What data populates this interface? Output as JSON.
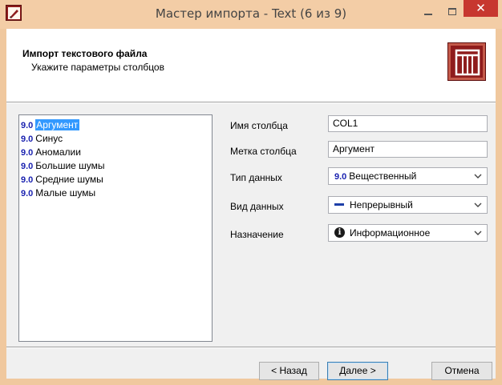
{
  "window": {
    "title": "Мастер импорта - Text (6 из 9)",
    "close_glyph": "✕"
  },
  "header": {
    "title": "Импорт текстового файла",
    "subtitle": "Укажите параметры столбцов"
  },
  "columns": {
    "selected_index": 0,
    "items": [
      {
        "type": "9.0",
        "label": "Аргумент"
      },
      {
        "type": "9.0",
        "label": "Синус"
      },
      {
        "type": "9.0",
        "label": "Аномалии"
      },
      {
        "type": "9.0",
        "label": "Большие шумы"
      },
      {
        "type": "9.0",
        "label": "Средние шумы"
      },
      {
        "type": "9.0",
        "label": "Малые шумы"
      }
    ]
  },
  "form": {
    "column_name": {
      "label": "Имя столбца",
      "value": "COL1"
    },
    "column_caption": {
      "label": "Метка столбца",
      "value": "Аргумент"
    },
    "data_type": {
      "label": "Тип данных",
      "badge": "9.0",
      "value": "Вещественный",
      "icon": "real-number-icon"
    },
    "data_kind": {
      "label": "Вид данных",
      "value": "Непрерывный",
      "icon": "continuous-dash-icon"
    },
    "purpose": {
      "label": "Назначение",
      "value": "Информационное",
      "icon": "info-icon"
    }
  },
  "buttons": {
    "back": "< Назад",
    "next": "Далее >",
    "cancel": "Отмена"
  },
  "colors": {
    "title_bar": "#f3cda6",
    "close_button": "#c7372f",
    "selection": "#3399ff",
    "type_badge": "#1a22b0",
    "logo": "#8f1c1c"
  }
}
